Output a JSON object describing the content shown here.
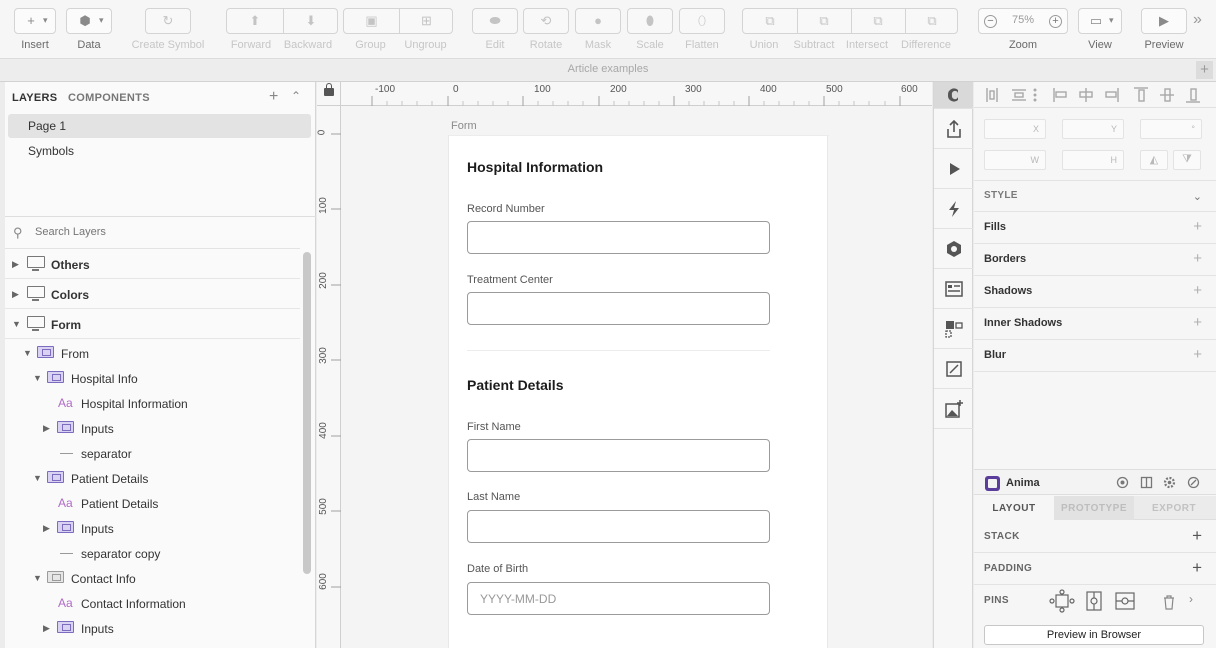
{
  "toolbar": {
    "insert": "Insert",
    "data": "Data",
    "create_symbol": "Create Symbol",
    "forward": "Forward",
    "backward": "Backward",
    "group": "Group",
    "ungroup": "Ungroup",
    "edit": "Edit",
    "rotate": "Rotate",
    "mask": "Mask",
    "scale": "Scale",
    "flatten": "Flatten",
    "union": "Union",
    "subtract": "Subtract",
    "intersect": "Intersect",
    "difference": "Difference",
    "zoom_label": "Zoom",
    "zoom_value": "75%",
    "view": "View",
    "preview": "Preview"
  },
  "document": {
    "title": "Article examples"
  },
  "left_panel": {
    "tab_layers": "LAYERS",
    "tab_components": "COMPONENTS",
    "pages": [
      "Page 1",
      "Symbols"
    ],
    "search_placeholder": "Search Layers",
    "layers": [
      {
        "name": "Others",
        "type": "artboard",
        "depth": 0,
        "expanded": false
      },
      {
        "name": "Colors",
        "type": "artboard",
        "depth": 0,
        "expanded": false
      },
      {
        "name": "Form",
        "type": "artboard",
        "depth": 0,
        "expanded": true
      },
      {
        "name": "From",
        "type": "group",
        "depth": 1,
        "expanded": true
      },
      {
        "name": "Hospital Info",
        "type": "group",
        "depth": 2,
        "expanded": true
      },
      {
        "name": "Hospital Information",
        "type": "text",
        "depth": 3
      },
      {
        "name": "Inputs",
        "type": "group",
        "depth": 3,
        "expanded": false
      },
      {
        "name": "separator",
        "type": "line",
        "depth": 3
      },
      {
        "name": "Patient Details",
        "type": "group",
        "depth": 2,
        "expanded": true
      },
      {
        "name": "Patient Details",
        "type": "text",
        "depth": 3
      },
      {
        "name": "Inputs",
        "type": "group",
        "depth": 3,
        "expanded": false
      },
      {
        "name": "separator copy",
        "type": "line",
        "depth": 3
      },
      {
        "name": "Contact Info",
        "type": "folder",
        "depth": 2,
        "expanded": true
      },
      {
        "name": "Contact Information",
        "type": "text",
        "depth": 3
      },
      {
        "name": "Inputs",
        "type": "group",
        "depth": 3,
        "expanded": false
      }
    ]
  },
  "canvas": {
    "ruler_x": [
      "-100",
      "0",
      "100",
      "200",
      "300",
      "400",
      "500",
      "600"
    ],
    "ruler_y": [
      "0",
      "100",
      "200",
      "300",
      "400",
      "500",
      "600"
    ],
    "artboard_name": "Form",
    "form": {
      "section1_title": "Hospital Information",
      "record_number_label": "Record Number",
      "treatment_center_label": "Treatment Center",
      "section2_title": "Patient Details",
      "first_name_label": "First Name",
      "last_name_label": "Last Name",
      "dob_label": "Date of Birth",
      "dob_placeholder": "YYYY-MM-DD"
    }
  },
  "inspector": {
    "fields": {
      "x": "X",
      "y": "Y",
      "rotation": "°",
      "w": "W",
      "h": "H"
    },
    "style_header": "STYLE",
    "sections": [
      "Fills",
      "Borders",
      "Shadows",
      "Inner Shadows",
      "Blur"
    ],
    "anima": {
      "title": "Anima",
      "tabs": [
        "LAYOUT",
        "PROTOTYPE",
        "EXPORT"
      ],
      "sections": [
        "STACK",
        "PADDING",
        "PINS"
      ],
      "preview_button": "Preview in Browser"
    }
  }
}
